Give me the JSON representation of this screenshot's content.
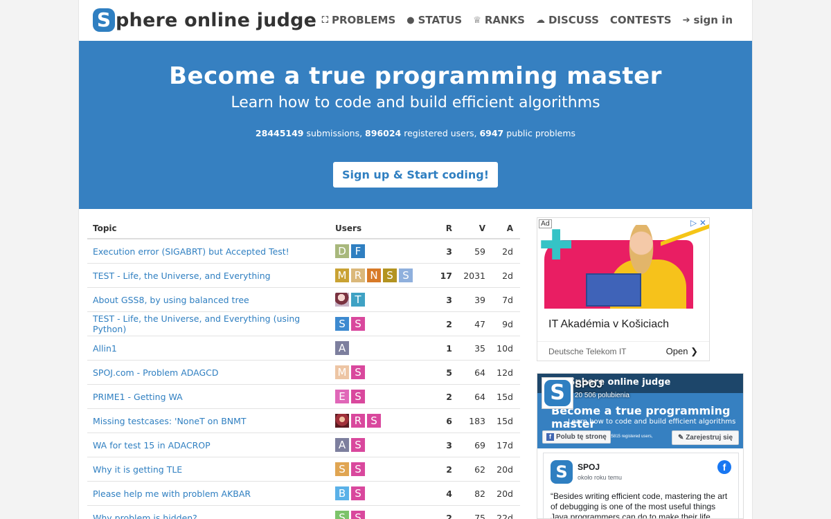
{
  "header": {
    "logo_letter": "S",
    "logo_text": "phere online judge",
    "nav": [
      {
        "icon": "sitemap-icon",
        "glyph": "⛶",
        "label": "PROBLEMS"
      },
      {
        "icon": "circle-icon",
        "glyph": "●",
        "label": "STATUS"
      },
      {
        "icon": "trophy-icon",
        "glyph": "♕",
        "label": "RANKS"
      },
      {
        "icon": "comments-icon",
        "glyph": "☁",
        "label": "DISCUSS"
      },
      {
        "icon": "",
        "glyph": "",
        "label": "CONTESTS"
      },
      {
        "icon": "sign-in-icon",
        "glyph": "➔",
        "label": "sign in"
      }
    ]
  },
  "hero": {
    "title": "Become a true programming master",
    "subtitle": "Learn how to code and build efficient algorithms",
    "submissions": "28445149",
    "submissions_label": " submissions, ",
    "users": "896024",
    "users_label": " registered users, ",
    "problems": "6947",
    "problems_label": " public problems",
    "cta": "Sign up & Start coding!"
  },
  "forum": {
    "headers": {
      "topic": "Topic",
      "users": "Users",
      "r": "R",
      "v": "V",
      "a": "A"
    },
    "rows": [
      {
        "topic": "Execution error (SIGABRT) but Accepted Test!",
        "users": [
          {
            "l": "D",
            "c": "#a8b87c"
          },
          {
            "l": "F",
            "c": "#2f7fc1"
          }
        ],
        "r": "3",
        "v": "59",
        "a": "2d"
      },
      {
        "topic": "TEST - Life, the Universe, and Everything",
        "users": [
          {
            "l": "M",
            "c": "#c9a233"
          },
          {
            "l": "R",
            "c": "#dbb87a"
          },
          {
            "l": "N",
            "c": "#d87a28"
          },
          {
            "l": "S",
            "c": "#b39320"
          },
          {
            "l": "S",
            "c": "#8fb0dd"
          }
        ],
        "r": "17",
        "v": "2031",
        "a": "2d"
      },
      {
        "topic": "About GSS8, by using balanced tree",
        "users": [
          {
            "l": "",
            "c": "img"
          },
          {
            "l": "T",
            "c": "#3fa2c4"
          }
        ],
        "r": "3",
        "v": "39",
        "a": "7d"
      },
      {
        "topic": "TEST - Life, the Universe, and Everything (using Python)",
        "users": [
          {
            "l": "S",
            "c": "#3d8ad0"
          },
          {
            "l": "S",
            "c": "#d9489d"
          }
        ],
        "r": "2",
        "v": "47",
        "a": "9d"
      },
      {
        "topic": "Allin1",
        "users": [
          {
            "l": "A",
            "c": "#7d7f9e"
          }
        ],
        "r": "1",
        "v": "35",
        "a": "10d"
      },
      {
        "topic": "SPOJ.com - Problem ADAGCD",
        "users": [
          {
            "l": "M",
            "c": "#edc5a4"
          },
          {
            "l": "S",
            "c": "#d9489d"
          }
        ],
        "r": "5",
        "v": "64",
        "a": "12d"
      },
      {
        "topic": "PRIME1 - Getting WA",
        "users": [
          {
            "l": "E",
            "c": "#e067b8"
          },
          {
            "l": "S",
            "c": "#d9489d"
          }
        ],
        "r": "2",
        "v": "64",
        "a": "15d"
      },
      {
        "topic": "Missing testcases: 'NoneT on BNMT",
        "users": [
          {
            "l": "",
            "c": "img2"
          },
          {
            "l": "R",
            "c": "#d9489d"
          },
          {
            "l": "S",
            "c": "#d9489d"
          }
        ],
        "r": "6",
        "v": "183",
        "a": "15d"
      },
      {
        "topic": "WA for test 15 in ADACROP",
        "users": [
          {
            "l": "A",
            "c": "#7d7f9e"
          },
          {
            "l": "S",
            "c": "#d9489d"
          }
        ],
        "r": "3",
        "v": "69",
        "a": "17d"
      },
      {
        "topic": "Why it is getting TLE",
        "users": [
          {
            "l": "S",
            "c": "#e0a552"
          },
          {
            "l": "S",
            "c": "#d9489d"
          }
        ],
        "r": "2",
        "v": "62",
        "a": "20d"
      },
      {
        "topic": "Please help me with problem AKBAR",
        "users": [
          {
            "l": "B",
            "c": "#5ab1e8"
          },
          {
            "l": "S",
            "c": "#d9489d"
          }
        ],
        "r": "4",
        "v": "82",
        "a": "20d"
      },
      {
        "topic": "Why problem is hidden?",
        "users": [
          {
            "l": "S",
            "c": "#7cc36a"
          },
          {
            "l": "S",
            "c": "#d9489d"
          }
        ],
        "r": "2",
        "v": "75",
        "a": "22d"
      }
    ]
  },
  "ad": {
    "label": "Ad",
    "title": "IT Akadémia v Košiciach",
    "sponsor": "Deutsche Telekom IT",
    "open": "Open"
  },
  "facebook": {
    "cover_brand": "Sphere online judge",
    "cover_title": "Become a true programming master",
    "cover_sub": "Learn how to code and build efficient algorithms",
    "cover_small": "525815 registered users,",
    "page_name": "SPOJ",
    "likes": "20 506 polubienia",
    "like_button": "Polub tę stronę",
    "signup_button": "Zarejestruj się",
    "post_name": "SPOJ",
    "post_time": "około roku temu",
    "post_text": "“Besides writing efficient code, mastering the art of debugging is one of the most useful things Java programmers can do to make their life easier.”"
  }
}
